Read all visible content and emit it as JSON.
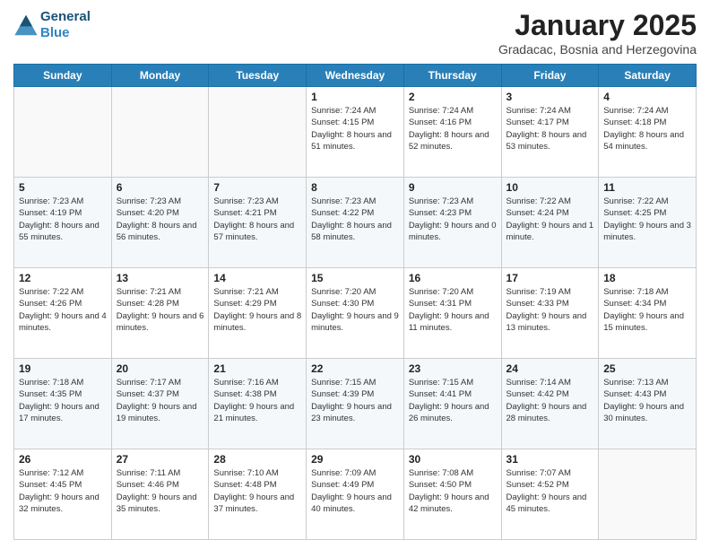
{
  "header": {
    "logo_line1": "General",
    "logo_line2": "Blue",
    "month": "January 2025",
    "location": "Gradacac, Bosnia and Herzegovina"
  },
  "weekdays": [
    "Sunday",
    "Monday",
    "Tuesday",
    "Wednesday",
    "Thursday",
    "Friday",
    "Saturday"
  ],
  "weeks": [
    [
      {
        "day": "",
        "info": ""
      },
      {
        "day": "",
        "info": ""
      },
      {
        "day": "",
        "info": ""
      },
      {
        "day": "1",
        "info": "Sunrise: 7:24 AM\nSunset: 4:15 PM\nDaylight: 8 hours and 51 minutes."
      },
      {
        "day": "2",
        "info": "Sunrise: 7:24 AM\nSunset: 4:16 PM\nDaylight: 8 hours and 52 minutes."
      },
      {
        "day": "3",
        "info": "Sunrise: 7:24 AM\nSunset: 4:17 PM\nDaylight: 8 hours and 53 minutes."
      },
      {
        "day": "4",
        "info": "Sunrise: 7:24 AM\nSunset: 4:18 PM\nDaylight: 8 hours and 54 minutes."
      }
    ],
    [
      {
        "day": "5",
        "info": "Sunrise: 7:23 AM\nSunset: 4:19 PM\nDaylight: 8 hours and 55 minutes."
      },
      {
        "day": "6",
        "info": "Sunrise: 7:23 AM\nSunset: 4:20 PM\nDaylight: 8 hours and 56 minutes."
      },
      {
        "day": "7",
        "info": "Sunrise: 7:23 AM\nSunset: 4:21 PM\nDaylight: 8 hours and 57 minutes."
      },
      {
        "day": "8",
        "info": "Sunrise: 7:23 AM\nSunset: 4:22 PM\nDaylight: 8 hours and 58 minutes."
      },
      {
        "day": "9",
        "info": "Sunrise: 7:23 AM\nSunset: 4:23 PM\nDaylight: 9 hours and 0 minutes."
      },
      {
        "day": "10",
        "info": "Sunrise: 7:22 AM\nSunset: 4:24 PM\nDaylight: 9 hours and 1 minute."
      },
      {
        "day": "11",
        "info": "Sunrise: 7:22 AM\nSunset: 4:25 PM\nDaylight: 9 hours and 3 minutes."
      }
    ],
    [
      {
        "day": "12",
        "info": "Sunrise: 7:22 AM\nSunset: 4:26 PM\nDaylight: 9 hours and 4 minutes."
      },
      {
        "day": "13",
        "info": "Sunrise: 7:21 AM\nSunset: 4:28 PM\nDaylight: 9 hours and 6 minutes."
      },
      {
        "day": "14",
        "info": "Sunrise: 7:21 AM\nSunset: 4:29 PM\nDaylight: 9 hours and 8 minutes."
      },
      {
        "day": "15",
        "info": "Sunrise: 7:20 AM\nSunset: 4:30 PM\nDaylight: 9 hours and 9 minutes."
      },
      {
        "day": "16",
        "info": "Sunrise: 7:20 AM\nSunset: 4:31 PM\nDaylight: 9 hours and 11 minutes."
      },
      {
        "day": "17",
        "info": "Sunrise: 7:19 AM\nSunset: 4:33 PM\nDaylight: 9 hours and 13 minutes."
      },
      {
        "day": "18",
        "info": "Sunrise: 7:18 AM\nSunset: 4:34 PM\nDaylight: 9 hours and 15 minutes."
      }
    ],
    [
      {
        "day": "19",
        "info": "Sunrise: 7:18 AM\nSunset: 4:35 PM\nDaylight: 9 hours and 17 minutes."
      },
      {
        "day": "20",
        "info": "Sunrise: 7:17 AM\nSunset: 4:37 PM\nDaylight: 9 hours and 19 minutes."
      },
      {
        "day": "21",
        "info": "Sunrise: 7:16 AM\nSunset: 4:38 PM\nDaylight: 9 hours and 21 minutes."
      },
      {
        "day": "22",
        "info": "Sunrise: 7:15 AM\nSunset: 4:39 PM\nDaylight: 9 hours and 23 minutes."
      },
      {
        "day": "23",
        "info": "Sunrise: 7:15 AM\nSunset: 4:41 PM\nDaylight: 9 hours and 26 minutes."
      },
      {
        "day": "24",
        "info": "Sunrise: 7:14 AM\nSunset: 4:42 PM\nDaylight: 9 hours and 28 minutes."
      },
      {
        "day": "25",
        "info": "Sunrise: 7:13 AM\nSunset: 4:43 PM\nDaylight: 9 hours and 30 minutes."
      }
    ],
    [
      {
        "day": "26",
        "info": "Sunrise: 7:12 AM\nSunset: 4:45 PM\nDaylight: 9 hours and 32 minutes."
      },
      {
        "day": "27",
        "info": "Sunrise: 7:11 AM\nSunset: 4:46 PM\nDaylight: 9 hours and 35 minutes."
      },
      {
        "day": "28",
        "info": "Sunrise: 7:10 AM\nSunset: 4:48 PM\nDaylight: 9 hours and 37 minutes."
      },
      {
        "day": "29",
        "info": "Sunrise: 7:09 AM\nSunset: 4:49 PM\nDaylight: 9 hours and 40 minutes."
      },
      {
        "day": "30",
        "info": "Sunrise: 7:08 AM\nSunset: 4:50 PM\nDaylight: 9 hours and 42 minutes."
      },
      {
        "day": "31",
        "info": "Sunrise: 7:07 AM\nSunset: 4:52 PM\nDaylight: 9 hours and 45 minutes."
      },
      {
        "day": "",
        "info": ""
      }
    ]
  ]
}
